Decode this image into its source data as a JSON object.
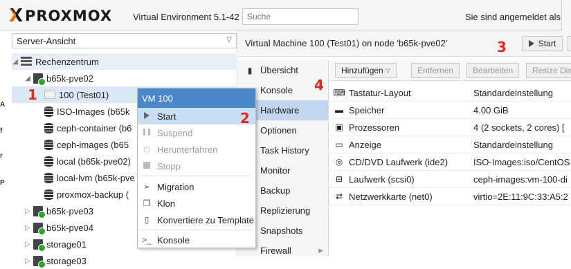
{
  "header": {
    "logo_text": "PROXMOX",
    "version": "Virtual Environment 5.1-42",
    "search_placeholder": "Suche",
    "login_text": "Sie sind angemeldet als 'ro"
  },
  "left": {
    "view_select": "Server-Ansicht",
    "tree": [
      {
        "label": "Rechenzentrum",
        "icon": "datacenter-icon"
      },
      {
        "label": "b65k-pve02",
        "icon": "server-icon"
      },
      {
        "label": "100 (Test01)",
        "icon": "vm-icon"
      },
      {
        "label": "ISO-Images (b65k",
        "icon": "storage-icon"
      },
      {
        "label": "ceph-container (b6",
        "icon": "storage-icon"
      },
      {
        "label": "ceph-images (b65",
        "icon": "storage-icon"
      },
      {
        "label": "local (b65k-pve02)",
        "icon": "storage-icon"
      },
      {
        "label": "local-lvm (b65k-pve",
        "icon": "storage-icon"
      },
      {
        "label": "proxmox-backup (",
        "icon": "storage-icon"
      },
      {
        "label": "b65k-pve03",
        "icon": "server-icon"
      },
      {
        "label": "b65k-pve04",
        "icon": "server-icon"
      },
      {
        "label": "storage01",
        "icon": "server-icon"
      },
      {
        "label": "storage03",
        "icon": "server-icon"
      }
    ],
    "edge_chars": [
      "A",
      "f",
      "r",
      "P"
    ]
  },
  "context_menu": {
    "title": "VM 100",
    "items": [
      {
        "label": "Start",
        "icon": "play-icon"
      },
      {
        "label": "Suspend",
        "icon": "pause-icon"
      },
      {
        "label": "Herunterfahren",
        "icon": "power-icon"
      },
      {
        "label": "Stopp",
        "icon": "stop-icon"
      },
      {
        "label": "Migration",
        "icon": "send-icon"
      },
      {
        "label": "Klon",
        "icon": "clone-icon"
      },
      {
        "label": "Konvertiere zu Template",
        "icon": "file-icon"
      },
      {
        "label": "Konsole",
        "icon": "terminal-icon"
      }
    ]
  },
  "right": {
    "vm_title": "Virtual Machine 100 (Test01) on node 'b65k-pve02'",
    "start_button": "Start",
    "nav": [
      {
        "label": "Übersicht",
        "icon": "book-icon"
      },
      {
        "label": "Konsole",
        "icon": "terminal-icon"
      },
      {
        "label": "Hardware",
        "icon": "desktop-icon"
      },
      {
        "label": "Optionen",
        "icon": "gear-icon"
      },
      {
        "label": "Task History",
        "icon": "list-icon"
      },
      {
        "label": "Monitor",
        "icon": "eye-icon"
      },
      {
        "label": "Backup",
        "icon": "floppy-icon"
      },
      {
        "label": "Replizierung",
        "icon": "retweet-icon"
      },
      {
        "label": "Snapshots",
        "icon": "history-icon"
      },
      {
        "label": "Firewall",
        "icon": "shield-icon"
      }
    ],
    "toolbar": {
      "add": "Hinzufügen",
      "remove": "Entfernen",
      "edit": "Bearbeiten",
      "resize": "Resize Dis"
    },
    "hardware": [
      {
        "key": "Tastatur-Layout",
        "value": "Standardeinstellung",
        "icon": "keyboard-icon"
      },
      {
        "key": "Speicher",
        "value": "4.00 GiB",
        "icon": "memory-icon"
      },
      {
        "key": "Prozessoren",
        "value": "4 (2 sockets, 2 cores) [",
        "icon": "cpu-icon"
      },
      {
        "key": "Anzeige",
        "value": "Standardeinstellung",
        "icon": "display-icon"
      },
      {
        "key": "CD/DVD Laufwerk (ide2)",
        "value": "ISO-Images:iso/CentOS",
        "icon": "cdrom-icon"
      },
      {
        "key": "Laufwerk (scsi0)",
        "value": "ceph-images:vm-100-di",
        "icon": "hdd-icon"
      },
      {
        "key": "Netzwerkkarte (net0)",
        "value": "virtio=2E:11:9C:33:A5:2",
        "icon": "network-icon"
      }
    ]
  },
  "annotations": [
    "1",
    "2",
    "3",
    "4"
  ],
  "colors": {
    "accent": "#e57000",
    "menu_header": "#4a88c8",
    "selection": "#c2d7ef",
    "annotation": "#e0281e",
    "status_ok": "#2fa52f"
  }
}
